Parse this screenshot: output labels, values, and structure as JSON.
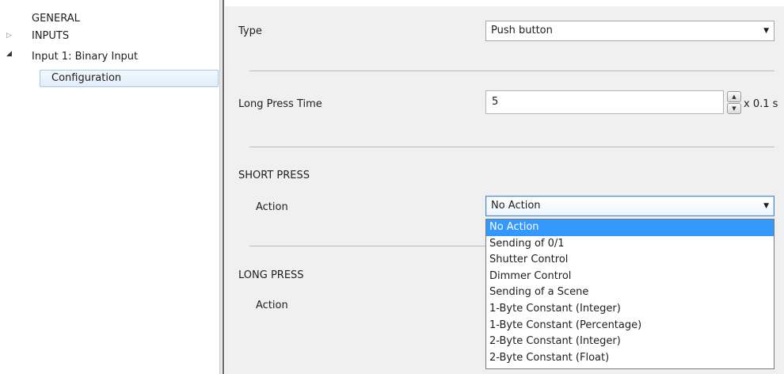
{
  "sidebar": {
    "items": [
      {
        "label": "GENERAL",
        "expander": ""
      },
      {
        "label": "INPUTS",
        "expander": "▷"
      },
      {
        "label": "Input 1: Binary Input",
        "expander": "◢"
      },
      {
        "label": "Configuration",
        "selected": true
      }
    ]
  },
  "form": {
    "type": {
      "label": "Type",
      "value": "Push button"
    },
    "long_press_time": {
      "label": "Long Press Time",
      "value": "5",
      "unit": "x 0.1 s"
    },
    "short_press": {
      "section": "SHORT PRESS",
      "action_label": "Action",
      "action_value": "No Action"
    },
    "long_press": {
      "section": "LONG PRESS",
      "action_label": "Action"
    }
  },
  "dropdown": {
    "options": [
      "No Action",
      "Sending of 0/1",
      "Shutter Control",
      "Dimmer Control",
      "Sending of a Scene",
      "1-Byte Constant (Integer)",
      "1-Byte Constant (Percentage)",
      "2-Byte Constant (Integer)",
      "2-Byte Constant (Float)"
    ],
    "selected": "No Action"
  },
  "colors": {
    "highlight": "#3399ff",
    "panel_bg": "#f0f0f0",
    "tree_select": "#e0edfa"
  }
}
